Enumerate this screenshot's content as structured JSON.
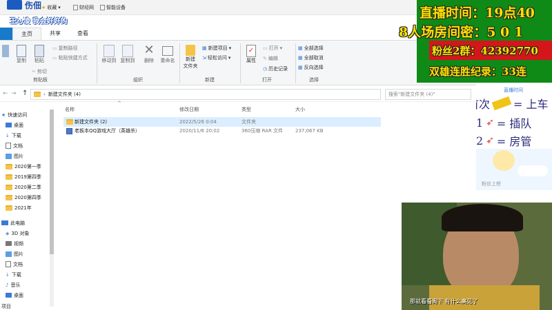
{
  "bookmarks": [
    {
      "label": "收藏"
    },
    {
      "label": "财经网"
    },
    {
      "label": "智能设备"
    }
  ],
  "stream_top_left": {
    "line1": "伤佃",
    "line2": "王心凌 我会好好的"
  },
  "ribbon_tabs": [
    "主页",
    "共享",
    "查看"
  ],
  "ribbon": {
    "clipboard": {
      "group": "剪贴板",
      "pin_label": "固定到快速访问",
      "copy": "复制",
      "paste": "粘贴",
      "copy_path": "复制路径",
      "paste_shortcut": "粘贴快捷方式",
      "cut": "剪切"
    },
    "organize": {
      "group": "组织",
      "move_to": "移动到",
      "copy_to": "复制到",
      "delete": "删除",
      "rename": "重命名"
    },
    "new": {
      "group": "新建",
      "new_folder": "新建\n文件夹",
      "new_item": "新建项目",
      "easy_access": "轻松访问"
    },
    "open": {
      "group": "打开",
      "properties": "属性",
      "open": "打开",
      "edit": "编辑",
      "history": "历史记录"
    },
    "select": {
      "group": "选择",
      "select_all": "全部选择",
      "select_none": "全部取消",
      "invert": "反向选择"
    }
  },
  "address": {
    "path": "新建文件夹 (4)",
    "search_placeholder": "搜索\"新建文件夹 (4)\""
  },
  "navpane": {
    "quick_access": "快速访问",
    "items": [
      "桌面",
      "下载",
      "文档",
      "图片",
      "2020第一季",
      "2019第四季",
      "2020第二季",
      "2020第四季",
      "2021年"
    ],
    "this_pc": "此电脑",
    "pc_items": [
      "3D 对象",
      "视频",
      "图片",
      "文档",
      "下载",
      "音乐",
      "桌面"
    ],
    "bottom": "项目"
  },
  "columns": {
    "name": "名称",
    "date": "修改日期",
    "type": "类型",
    "size": "大小"
  },
  "files": [
    {
      "name": "新建文件夹 (2)",
      "date": "2022/5/26 0:04",
      "type": "文件夹",
      "size": ""
    },
    {
      "name": "老板本QQ游戏大厅（英雄杀）",
      "date": "2020/11/6 20:02",
      "type": "360压缩 RAR 文件",
      "size": "237,067 KB"
    }
  ],
  "overlay": {
    "line1": "直播时间：19点40",
    "line2": "8人场房间密：5 0 1",
    "line3": "粉丝2群：42392770",
    "line4": "双雄连胜纪录：33连"
  },
  "right_panel": {
    "top": "直播时间",
    "rules": [
      {
        "prefix": "首次",
        "suffix": "= 上车"
      },
      {
        "prefix": "1",
        "suffix": "= 插队"
      },
      {
        "prefix": "2",
        "suffix": "= 房管"
      }
    ],
    "bottom_label": "粉丝上榜"
  },
  "video": {
    "subtitle": "那就看看阁下 有什么高见了"
  },
  "colors": {
    "overlay_yellow": "#ffe100",
    "overlay_bg": "#0f8a17",
    "selection": "#cce8ff"
  }
}
